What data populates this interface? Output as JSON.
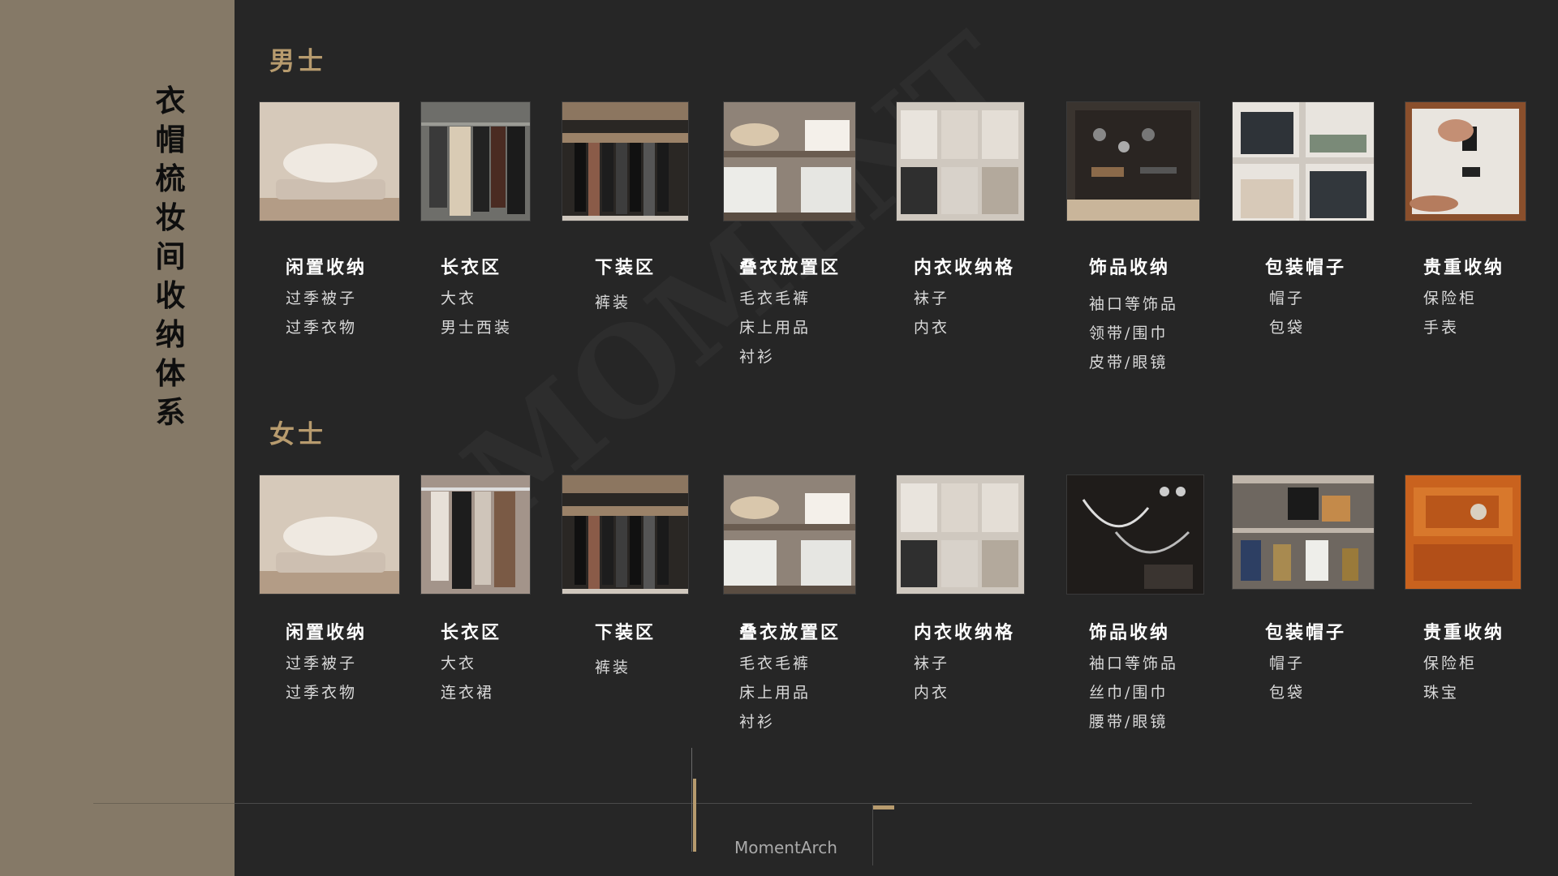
{
  "page": {
    "title": "衣帽梳妆间收纳体系",
    "brand": "MomentArch"
  },
  "men": {
    "title": "男士",
    "items": [
      {
        "label": "闲置收纳",
        "subs": [
          "过季被子",
          "过季衣物"
        ],
        "icon": "pillow-stack-photo"
      },
      {
        "label": "长衣区",
        "subs": [
          "大衣",
          "男士西装"
        ],
        "icon": "hanging-coats-photo"
      },
      {
        "label": "下装区",
        "subs": [
          "裤装"
        ],
        "icon": "trouser-rack-photo"
      },
      {
        "label": "叠衣放置区",
        "subs": [
          "毛衣毛裤",
          "床上用品",
          "衬衫"
        ],
        "icon": "folded-clothes-shelf-photo"
      },
      {
        "label": "内衣收纳格",
        "subs": [
          "袜子",
          "内衣"
        ],
        "icon": "underwear-drawer-photo"
      },
      {
        "label": "饰品收纳",
        "subs": [
          "袖口等饰品",
          "领带/围巾",
          "皮带/眼镜"
        ],
        "icon": "accessory-drawer-photo"
      },
      {
        "label": "包装帽子",
        "subs": [
          "帽子",
          "包袋"
        ],
        "icon": "hat-box-shelf-photo"
      },
      {
        "label": "贵重收纳",
        "subs": [
          "保险柜",
          "手表"
        ],
        "icon": "safe-photo"
      }
    ]
  },
  "women": {
    "title": "女士",
    "items": [
      {
        "label": "闲置收纳",
        "subs": [
          "过季被子",
          "过季衣物"
        ],
        "icon": "pillow-stack-photo"
      },
      {
        "label": "长衣区",
        "subs": [
          "大衣",
          "连衣裙"
        ],
        "icon": "hanging-dresses-photo"
      },
      {
        "label": "下装区",
        "subs": [
          "裤装"
        ],
        "icon": "trouser-rack-photo"
      },
      {
        "label": "叠衣放置区",
        "subs": [
          "毛衣毛裤",
          "床上用品",
          "衬衫"
        ],
        "icon": "folded-clothes-shelf-photo"
      },
      {
        "label": "内衣收纳格",
        "subs": [
          "袜子",
          "内衣"
        ],
        "icon": "underwear-drawer-photo"
      },
      {
        "label": "饰品收纳",
        "subs": [
          "袖口等饰品",
          "丝巾/围巾",
          "腰带/眼镜"
        ],
        "icon": "jewelry-drawer-photo"
      },
      {
        "label": "包装帽子",
        "subs": [
          "帽子",
          "包袋"
        ],
        "icon": "handbag-shelf-photo"
      },
      {
        "label": "贵重收纳",
        "subs": [
          "保险柜",
          "珠宝"
        ],
        "icon": "jewelry-case-photo"
      }
    ]
  },
  "colors": {
    "accent": "#b79b6e",
    "sidebar": "#857967",
    "background": "#262626"
  }
}
